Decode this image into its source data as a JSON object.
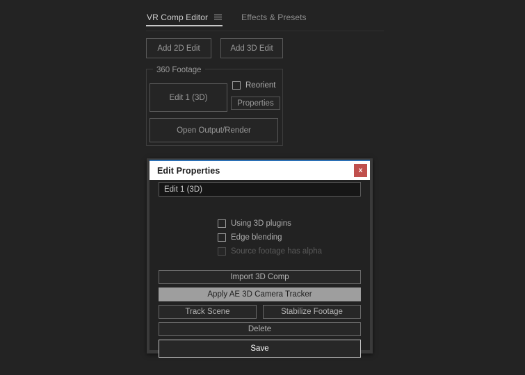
{
  "panel": {
    "tabs": [
      {
        "label": "VR Comp Editor",
        "active": true,
        "menu_icon": "hamburger-icon"
      },
      {
        "label": "Effects & Presets",
        "active": false
      }
    ]
  },
  "toolbar": {
    "add_2d_label": "Add 2D Edit",
    "add_3d_label": "Add 3D Edit"
  },
  "footage_group": {
    "legend": "360 Footage",
    "edit_button_label": "Edit 1 (3D)",
    "reorient_label": "Reorient",
    "reorient_checked": false,
    "properties_label": "Properties",
    "open_render_label": "Open Output/Render"
  },
  "dialog": {
    "title": "Edit Properties",
    "close_label": "x",
    "name_value": "Edit 1 (3D)",
    "name_placeholder": "Edit name",
    "checkboxes": [
      {
        "label": "Using 3D plugins",
        "checked": false,
        "disabled": false
      },
      {
        "label": "Edge blending",
        "checked": false,
        "disabled": false
      },
      {
        "label": "Source footage has alpha",
        "checked": false,
        "disabled": true
      }
    ],
    "buttons": {
      "import_3d": "Import 3D Comp",
      "apply_tracker": "Apply AE 3D Camera Tracker",
      "track_scene": "Track Scene",
      "stabilize": "Stabilize Footage",
      "delete": "Delete",
      "save": "Save"
    }
  },
  "colors": {
    "panel_bg": "#232323",
    "dialog_bg": "#222222",
    "dialog_frame": "#3a3a3a",
    "titlebar_bg": "#ffffff",
    "accent_line": "#2a6fb5",
    "close_red": "#c0504d",
    "highlight": "#9e9e9e"
  }
}
